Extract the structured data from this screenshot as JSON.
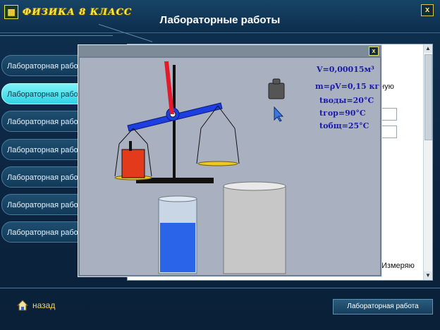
{
  "app": {
    "brand_label": "ФИЗИКА 8 КЛАСС",
    "title": "Лабораторные работы",
    "close_label": "x"
  },
  "sidebar": {
    "items": [
      {
        "label": "Лабораторная работа"
      },
      {
        "label": "Лабораторная работа",
        "active": true
      },
      {
        "label": "Лабораторная работа"
      },
      {
        "label": "Лабораторная работа"
      },
      {
        "label": "Лабораторная работа"
      },
      {
        "label": "Лабораторная работа"
      },
      {
        "label": "Лабораторная работа"
      }
    ]
  },
  "content": {
    "fragment_1": "ную",
    "fragment_2": "Измеряю"
  },
  "simulation": {
    "close_label": "x",
    "readouts": {
      "volume": "V=0,00015м³",
      "mass": "m=ρV=0,15 кг",
      "t_water": "tводы=20°C",
      "t_hot": "tгор=90°C",
      "t_total": "tобщ=25°C"
    },
    "colors": {
      "water_hot": "#e23a1a",
      "water_cold": "#2a64e8",
      "arm": "#1d3fe0",
      "pointer": "#e21a2a"
    }
  },
  "footer": {
    "back_label": "назад",
    "tab_label": "Лабораторная работа"
  },
  "icons": {
    "home": "home-icon",
    "cursor": "arrow-cursor-icon",
    "weight": "weight-icon"
  }
}
